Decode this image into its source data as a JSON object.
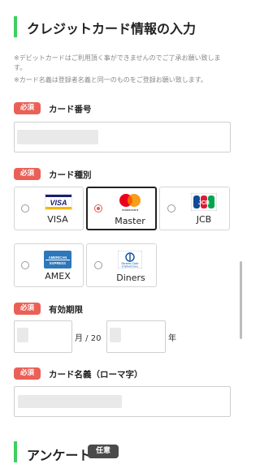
{
  "section": {
    "title": "クレジットカード情報の入力"
  },
  "notes": [
    "※デビットカードはご利用頂く事ができませんのでご了承お願い致します。",
    "※カード名義は登録者名義と同一のものをご登録お願い致します。"
  ],
  "required_label": "必須",
  "card_number": {
    "label": "カード番号",
    "value_masked": ""
  },
  "card_type": {
    "label": "カード種別",
    "options": [
      {
        "name": "VISA",
        "logo_text": "VISA",
        "icon": "visa-logo"
      },
      {
        "name": "Master",
        "logo_text": "mastercard",
        "icon": "mastercard-logo"
      },
      {
        "name": "JCB",
        "logo_text": "JCB",
        "icon": "jcb-logo"
      },
      {
        "name": "AMEX",
        "logo_text": "AMERICAN EXPRESS",
        "icon": "amex-logo"
      },
      {
        "name": "Diners",
        "logo_text": "Diners Club INTERNATIONAL",
        "icon": "diners-logo"
      }
    ],
    "selected": "Master"
  },
  "expiry": {
    "label": "有効期限",
    "month_suffix": "月 / 20",
    "year_suffix": "年"
  },
  "card_holder": {
    "label": "カード名義（ローマ字）"
  },
  "survey": {
    "title": "アンケート",
    "badge": "任意"
  },
  "colors": {
    "accent_green": "#3ecf5f",
    "required_red": "#ea6057",
    "radio_selected": "#e05a52",
    "optional_badge": "#4a4a4a"
  }
}
